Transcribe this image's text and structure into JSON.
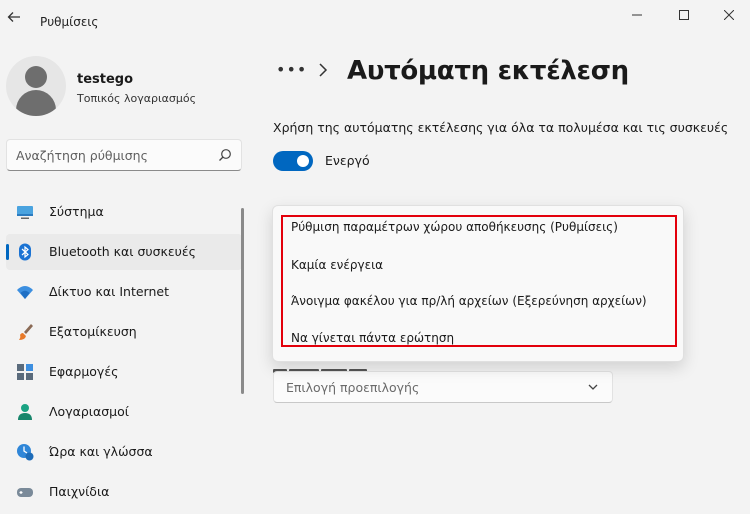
{
  "window": {
    "title": "Ρυθμίσεις"
  },
  "profile": {
    "username": "testego",
    "account_type": "Τοπικός λογαριασμός"
  },
  "search": {
    "placeholder": "Αναζήτηση ρύθμισης"
  },
  "sidebar": {
    "items": [
      {
        "label": "Σύστημα",
        "icon": "system-icon",
        "active": false
      },
      {
        "label": "Bluetooth και συσκευές",
        "icon": "bluetooth-icon",
        "active": true
      },
      {
        "label": "Δίκτυο και Internet",
        "icon": "wifi-icon",
        "active": false
      },
      {
        "label": "Εξατομίκευση",
        "icon": "personalization-brush-icon",
        "active": false
      },
      {
        "label": "Εφαρμογές",
        "icon": "apps-icon",
        "active": false
      },
      {
        "label": "Λογαριασμοί",
        "icon": "accounts-icon",
        "active": false
      },
      {
        "label": "Ώρα και γλώσσα",
        "icon": "time-language-icon",
        "active": false
      },
      {
        "label": "Παιχνίδια",
        "icon": "gaming-icon",
        "active": false
      }
    ]
  },
  "page": {
    "breadcrumb_more": "•••",
    "title": "Αυτόματη εκτέλεση"
  },
  "autoplay": {
    "description": "Χρήση της αυτόματης εκτέλεσης για όλα τα πολυμέσα και τις συσκευές",
    "toggle_label": "Ενεργό",
    "toggle_on": true
  },
  "dropdown": {
    "options": [
      "Ρύθμιση παραμέτρων χώρου αποθήκευσης (Ρυθμίσεις)",
      "Καμία ενέργεια",
      "Άνοιγμα φακέλου για πρ/λή αρχείων (Εξερεύνηση αρχείων)",
      "Να γίνεται πάντα ερώτηση"
    ]
  },
  "default_selector": {
    "label": "Επιλογή προεπιλογής"
  },
  "colors": {
    "accent": "#0067c0",
    "highlight": "#e3000b",
    "background": "#f3f3f3"
  }
}
